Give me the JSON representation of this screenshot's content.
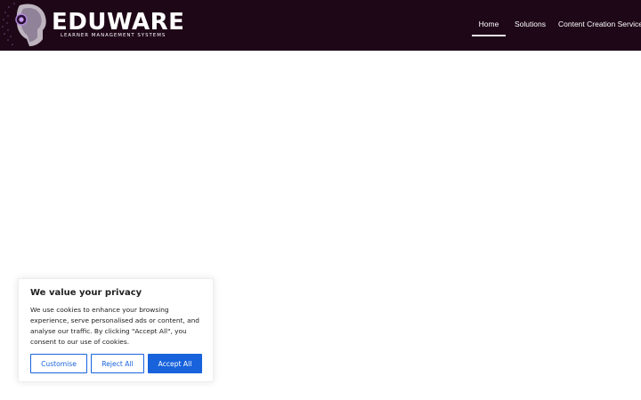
{
  "brand": {
    "name": "EDUWARE",
    "tagline": "LEARNER MANAGEMENT SYSTEMS",
    "bg_color": "#1e0717"
  },
  "nav": {
    "items": [
      {
        "label": "Home",
        "active": true
      },
      {
        "label": "Solutions",
        "active": false
      },
      {
        "label": "Content Creation Services",
        "active": false
      }
    ]
  },
  "cookie_banner": {
    "title": "We value your privacy",
    "body": "We use cookies to enhance your browsing experience, serve personalised ads or content, and analyse our traffic. By clicking \"Accept All\", you consent to our use of cookies.",
    "customise_label": "Customise",
    "reject_label": "Reject All",
    "accept_label": "Accept All",
    "accent_color": "#1863dc"
  }
}
